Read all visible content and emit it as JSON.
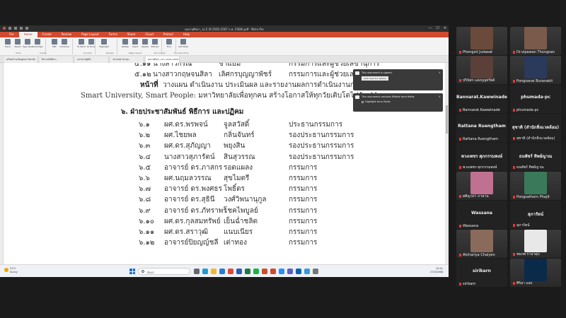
{
  "window": {
    "title": "ผลงานศึกษา_วอ.5 (ปี 2565-2567 ก.พ. 2568).pdf - Nitro Pro",
    "minimize": "—",
    "maximize": "☐",
    "close": "✕"
  },
  "menu": {
    "tabs": [
      "File",
      "Home",
      "Create",
      "Review",
      "Page Layout",
      "Forms",
      "Share",
      "Cloud",
      "Protect",
      "Help"
    ],
    "active_index": 1
  },
  "ribbon": {
    "tools": [
      "Hand",
      "Select",
      "Type Text",
      "QuickSign",
      "PDF",
      "Combine",
      "To Word",
      "To Excel",
      "Highlight",
      "Rotate",
      "Insert",
      "Delete",
      "Extract",
      "Find",
      "Add Note"
    ],
    "groups": [
      "Tools",
      "Create",
      "Convert",
      "Review",
      "Page Layout",
      "Document",
      "Favorite Tools"
    ],
    "zoom_label": "Zoom"
  },
  "doc_tabs": [
    "เตรียมสำรองข้อมูลมหาวิทยาลัย",
    "ฝึกงานนักศึกษา...",
    "แนวทางปฏิบัติ...",
    "78-2568 ประชุม...",
    "ผลงานศึกษา_วอ.5 (2565-2568 ก.พ..."
  ],
  "document": {
    "lines": [
      {
        "num": "๕.๑๑",
        "name": "นางสาวกรณี",
        "surname": "ชำแย้ม",
        "role": "กรรมการและผู้ช่วยเลขานุการ"
      },
      {
        "num": "๕.๑๒",
        "name": "นางสาวกฤษจนสิลา",
        "surname": "เลิศกรบุญญาพัชร์",
        "role": "กรรมการและผู้ช่วยเลขานุการ"
      }
    ],
    "duty_label": "หน้าที่",
    "duty_text": "วางแผน ดำเนินงาน ประเมินผล และรายงานผลการดำเนินงานการจัด",
    "slogan": "Smart University, Smart People: มหาวิทยาลัยเพื่อทุกคน สร้างโอกาสให้ทุกวัยเติบโตไปกับ AI",
    "section_title": "๖. ฝ่ายประชาสัมพันธ์ พิธีการ และปฏิคม",
    "members": [
      {
        "num": "๖.๑",
        "name": "ผศ.ดร.พรพจน์",
        "surname": "จูลสวัสดิ์",
        "role": "ประธานกรรมการ"
      },
      {
        "num": "๖.๒",
        "name": "ผศ.ไชยพล",
        "surname": "กลิ่นจันทร์",
        "role": "รองประธานกรรมการ"
      },
      {
        "num": "๖.๓",
        "name": "ผศ.ดร.สุภัญญา",
        "surname": "พยุงสิน",
        "role": "รองประธานกรรมการ"
      },
      {
        "num": "๖.๔",
        "name": "นางสาวสุภารัตน์",
        "surname": "สินสุวรรณ",
        "role": "รองประธานกรรมการ"
      },
      {
        "num": "๖.๕",
        "name": "อาจารย์ ดร.ภาสกร",
        "surname": "รอดแผลง",
        "role": "กรรมการ"
      },
      {
        "num": "๖.๖",
        "name": "ผศ.นฤมลวรรณ",
        "surname": "สุขไมตรี",
        "role": "กรรมการ"
      },
      {
        "num": "๖.๗",
        "name": "อาจารย์ ดร.พงศธร",
        "surname": "โพธิ์ดร",
        "role": "กรรมการ"
      },
      {
        "num": "๖.๘",
        "name": "อาจารย์ ดร.สุธินี",
        "surname": "วงศ์วิพนานุกูล",
        "role": "กรรมการ"
      },
      {
        "num": "๖.๙",
        "name": "อาจารย์ ดร.ภัทราพร",
        "surname": "โชคไพบูลย์",
        "role": "กรรมการ"
      },
      {
        "num": "๖.๑๐",
        "name": "ผศ.ดร.กุลสมทรัพย์",
        "surname": "เย็นฉ่ำชลิต",
        "role": "กรรมการ"
      },
      {
        "num": "๖.๑๑",
        "name": "ผศ.ดร.สราวุฒิ",
        "surname": "แนบเนียร",
        "role": "กรรมการ"
      },
      {
        "num": "๖.๑๒",
        "name": "อาจารย์ปิยญญ์ชลี",
        "surname": "เต่าทอง",
        "role": "กรรมการ"
      }
    ]
  },
  "notifications": [
    {
      "text": "This document is signed.",
      "button": "Click here for options"
    },
    {
      "text": "This document contains fillable form fields.",
      "check": "Highlight form fields"
    }
  ],
  "statusbar": {
    "page": "7 OF 17",
    "zoom": "100%"
  },
  "taskbar": {
    "weather_temp": "31°C",
    "weather_text": "Sunny",
    "search_placeholder": "ค้นหา",
    "time": "10:41",
    "date": "27/3/2568"
  },
  "gallery": {
    "participants": [
      {
        "name": "Phongsit Judaeat",
        "type": "video",
        "color": "#6a4a3a"
      },
      {
        "name": "Dr.vipawan Thongsan",
        "type": "video",
        "color": "#7a5a4a"
      },
      {
        "name": "ปรินัพร แสงบุญทรัพย์",
        "type": "video",
        "color": "#5a4038"
      },
      {
        "name": "Pongsanai Buranakit",
        "type": "video",
        "color": "#2a3a5a"
      },
      {
        "name": "Bannarat.Kawwinade",
        "type": "text"
      },
      {
        "name": "phumada-pc",
        "type": "text"
      },
      {
        "name": "Rattana Ruengtham",
        "type": "text"
      },
      {
        "name": "สุชาติ (สำนักสิ่งแวดล้อม)",
        "type": "text"
      },
      {
        "name": "พวงเพชร ศุภกรรมพงษ์",
        "type": "text"
      },
      {
        "name": "ธนพัชร์ ทิพย์ญาณ",
        "type": "text"
      },
      {
        "name": "ศศิญาดา ภาษาน",
        "type": "video",
        "color": "#c07090"
      },
      {
        "name": "Pongsathorn Phajit",
        "type": "video",
        "color": "#3a7a5a"
      },
      {
        "name": "Wassana",
        "type": "text"
      },
      {
        "name": "สุภารัตน์",
        "type": "text"
      },
      {
        "name": "Atchariya Chaiyen",
        "type": "video",
        "color": "#8a6a5a"
      },
      {
        "name": "ชยภพ กาลาตุบ",
        "type": "video",
        "color": "#e8e8e8"
      },
      {
        "name": "sirikarn",
        "type": "text"
      },
      {
        "name": "ศิริมา แสง",
        "type": "video",
        "color": "#0a2a4a"
      }
    ]
  }
}
